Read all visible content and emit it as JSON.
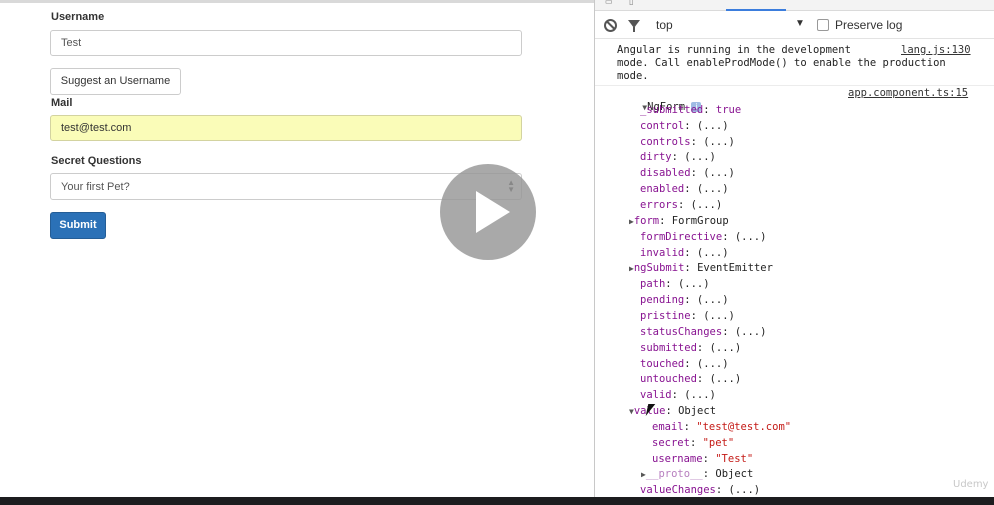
{
  "form": {
    "username_label": "Username",
    "username_value": "Test",
    "suggest_button": "Suggest an Username",
    "mail_label": "Mail",
    "mail_value": "test@test.com",
    "secret_label": "Secret Questions",
    "secret_selected": "Your first Pet?",
    "submit_button": "Submit"
  },
  "devtools": {
    "context": "top",
    "preserve_log": "Preserve log",
    "message1": {
      "lines": [
        "Angular is running in the development",
        "mode. Call enableProdMode() to enable the production",
        "mode."
      ],
      "source": "lang.js:130"
    },
    "message2_source": "app.component.ts:15",
    "object_name": "NgForm",
    "props": [
      {
        "key": "_submitted",
        "val": "true"
      },
      {
        "key": "control",
        "val": "(...)"
      },
      {
        "key": "controls",
        "val": "(...)"
      },
      {
        "key": "dirty",
        "val": "(...)"
      },
      {
        "key": "disabled",
        "val": "(...)"
      },
      {
        "key": "enabled",
        "val": "(...)"
      },
      {
        "key": "errors",
        "val": "(...)"
      },
      {
        "key": "form",
        "val": "FormGroup"
      },
      {
        "key": "formDirective",
        "val": "(...)"
      },
      {
        "key": "invalid",
        "val": "(...)"
      },
      {
        "key": "ngSubmit",
        "val": "EventEmitter"
      },
      {
        "key": "path",
        "val": "(...)"
      },
      {
        "key": "pending",
        "val": "(...)"
      },
      {
        "key": "pristine",
        "val": "(...)"
      },
      {
        "key": "statusChanges",
        "val": "(...)"
      },
      {
        "key": "submitted",
        "val": "(...)"
      },
      {
        "key": "touched",
        "val": "(...)"
      },
      {
        "key": "untouched",
        "val": "(...)"
      },
      {
        "key": "valid",
        "val": "(...)"
      },
      {
        "key": "value",
        "val": "Object"
      },
      {
        "key": "email",
        "val": "\"test@test.com\""
      },
      {
        "key": "secret",
        "val": "\"pet\""
      },
      {
        "key": "username",
        "val": "\"Test\""
      },
      {
        "key": "__proto__",
        "val": "Object"
      },
      {
        "key": "valueChanges",
        "val": "(...)"
      }
    ]
  },
  "watermark": "Udemy",
  "colors": {
    "primary": "#2b71b7",
    "autofill": "#fafcb8",
    "key": "#881391",
    "string": "#c41a16"
  }
}
